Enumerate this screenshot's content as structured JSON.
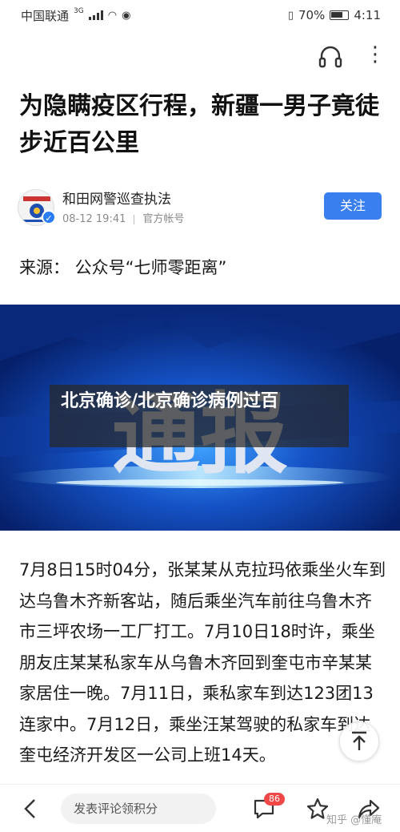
{
  "status_bar": {
    "carrier": "中国联通",
    "network": "3G",
    "battery_percent": "70%",
    "time": "4:11"
  },
  "article": {
    "title": "为隐瞒疫区行程，新疆一男子竟徒步近百公里",
    "source": "来源： 公众号“七师零距离”",
    "body": "7月8日15时04分，张某某从克拉玛依乘坐火车到达乌鲁木齐新客站，随后乘坐汽车前往乌鲁木齐市三坪农场一工厂打工。7月10日18时许，乘坐朋友庄某某私家车从乌鲁木齐回到奎屯市辛某某家居住一晚。7月11日，乘私家车到达123团13连家中。7月12日，乘坐汪某驾驶的私家车到达奎屯经济开发区一公司上班14天。"
  },
  "author": {
    "name": "和田网警巡查执法",
    "date": "08-12 19:41",
    "account_type": "官方帐号",
    "follow_label": "关注"
  },
  "image": {
    "caption": "北京确诊/北京确诊病例过百",
    "banner_text": "通报"
  },
  "bottom_bar": {
    "comment_placeholder": "发表评论领积分",
    "comment_count": "86"
  },
  "watermark": "知乎 @懂庵",
  "colors": {
    "accent": "#3a7ff0",
    "badge": "#f04848",
    "image_bg": "#0a2a7c"
  },
  "icons": [
    "back-icon",
    "comment-icon",
    "star-icon",
    "share-icon",
    "headphone-icon",
    "more-icon",
    "scroll-top-icon"
  ]
}
